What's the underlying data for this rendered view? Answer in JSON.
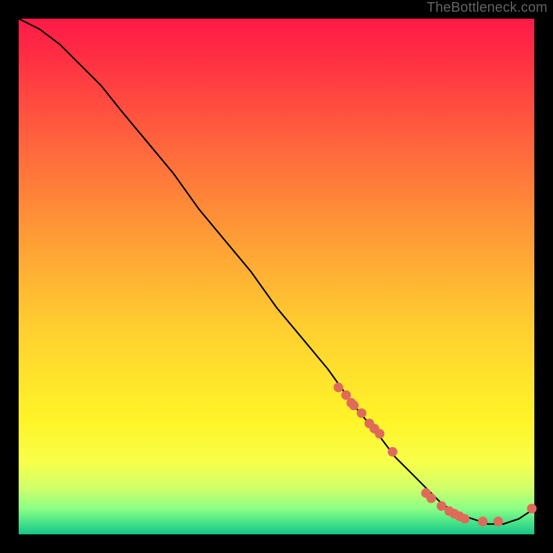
{
  "watermark": "TheBottleneck.com",
  "chart_data": {
    "type": "line",
    "title": "",
    "xlabel": "",
    "ylabel": "",
    "xlim": [
      0,
      100
    ],
    "ylim": [
      0,
      100
    ],
    "grid": false,
    "series": [
      {
        "name": "bottleneck-curve",
        "x": [
          0,
          4,
          8,
          12,
          16,
          20,
          25,
          30,
          35,
          40,
          45,
          50,
          55,
          60,
          65,
          70,
          73,
          76,
          79,
          82,
          85,
          88,
          91,
          94,
          97,
          100
        ],
        "y": [
          100,
          98,
          95,
          91,
          87,
          82,
          76,
          70,
          63,
          57,
          51,
          44,
          38,
          32,
          25,
          19,
          15,
          12,
          9,
          6,
          4,
          3,
          2,
          2,
          3,
          5
        ]
      }
    ],
    "scatter": {
      "name": "marker-points",
      "x": [
        62,
        63.5,
        64.5,
        65,
        66.5,
        68,
        69,
        70,
        72.5,
        79,
        80,
        82,
        83.5,
        84.5,
        85.5,
        86.5,
        90,
        93,
        99.5
      ],
      "y": [
        28.5,
        27,
        25.5,
        25,
        23.5,
        21.5,
        20.5,
        19.5,
        16,
        8,
        7,
        5.5,
        4.5,
        4,
        3.5,
        3,
        2.5,
        2.5,
        5
      ]
    },
    "marker_radius": 7,
    "curve_color": "#000000",
    "marker_color": "#e06a5a"
  }
}
